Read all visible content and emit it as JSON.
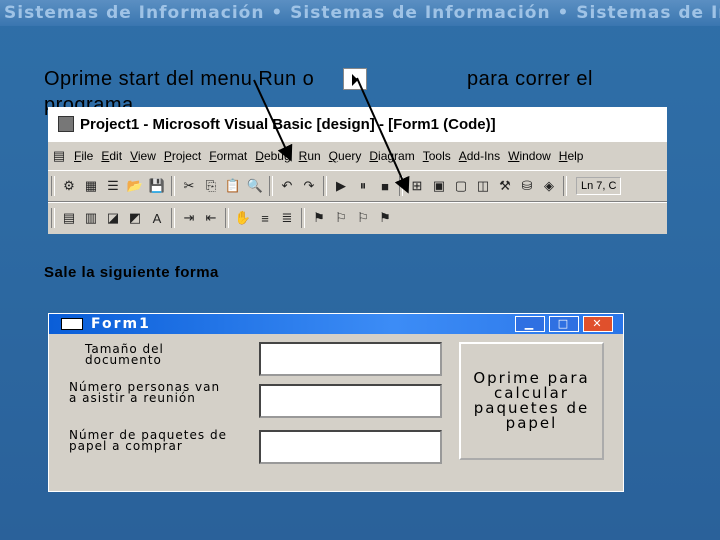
{
  "banner": {
    "text": "Sistemas de Información • Sistemas de Información • Sistemas de Información"
  },
  "slide": {
    "instruction_part1": "Oprime start del menu Run o",
    "instruction_part2": "para correr el",
    "instruction_part3": "programa",
    "subheading": "Sale la siguiente forma"
  },
  "vb": {
    "title": "Project1 - Microsoft Visual Basic [design] - [Form1 (Code)]",
    "menus": [
      "File",
      "Edit",
      "View",
      "Project",
      "Format",
      "Debug",
      "Run",
      "Query",
      "Diagram",
      "Tools",
      "Add-Ins",
      "Window",
      "Help"
    ],
    "position": "Ln 7, C"
  },
  "form": {
    "title": "Form1",
    "labels": [
      "Tamaño del documento",
      "Número personas van a asistir a reunión",
      "Númer de paquetes de papel a comprar"
    ],
    "button_label": "Oprime para calcular paquetes de papel"
  }
}
